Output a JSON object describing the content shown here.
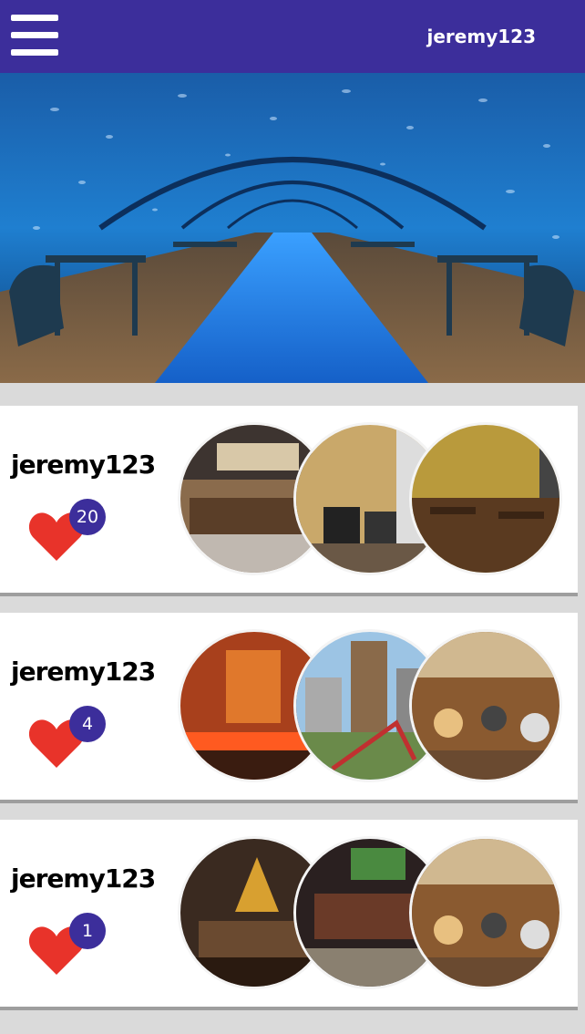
{
  "header": {
    "username": "jeremy123",
    "menu_icon": "hamburger-menu-icon",
    "background": "#3c2e9b"
  },
  "hero": {
    "description_icon": "underwater-restaurant-photo"
  },
  "posts": [
    {
      "username": "jeremy123",
      "likes": "20",
      "photos": [
        "bar-counter-photo",
        "lounge-chairs-photo",
        "dining-room-photo"
      ]
    },
    {
      "username": "jeremy123",
      "likes": "4",
      "photos": [
        "orange-bar-photo",
        "city-sculpture-photo",
        "busy-restaurant-photo"
      ]
    },
    {
      "username": "jeremy123",
      "likes": "1",
      "photos": [
        "chandelier-bar-photo",
        "sports-bar-photo",
        "busy-restaurant-photo"
      ]
    }
  ],
  "colors": {
    "accent": "#3c2e9b",
    "heart": "#e8332a"
  }
}
